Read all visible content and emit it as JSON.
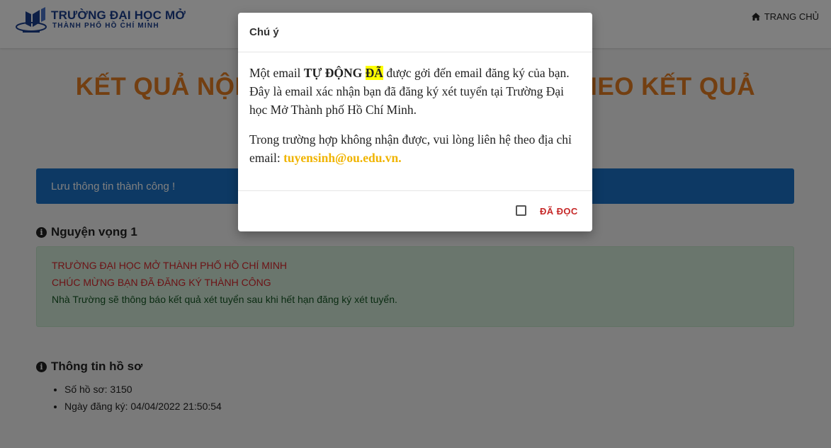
{
  "header": {
    "logo_line1": "TRƯỜNG ĐẠI HỌC MỞ",
    "logo_line2": "THÀNH PHỐ HỒ CHÍ MINH",
    "logo_icon": "university-book-logo",
    "nav_home_icon": "home-icon",
    "nav_home_label": "TRANG CHỦ"
  },
  "page": {
    "title_left": "KẾT QUẢ NỘP H",
    "title_right": "THEO KẾT QUẢ",
    "alert": "Lưu thông tin thành công !",
    "wish_heading": "Nguyện vọng 1",
    "wish_line1": "TRƯỜNG ĐẠI HỌC MỞ THÀNH PHỐ HỒ CHÍ MINH",
    "wish_line2": "CHÚC MỪNG BẠN ĐÃ ĐĂNG KÝ THÀNH CÔNG",
    "wish_line3": "Nhà Trường sẽ thông báo kết quả xét tuyển sau khi hết hạn đăng ký xét tuyển.",
    "profile_heading": "Thông tin hồ sơ",
    "profile_items": [
      "Số hồ sơ: 3150",
      "Ngày đăng ký: 04/04/2022 21:50:54"
    ]
  },
  "modal": {
    "title": "Chú ý",
    "p1_a": "Một email ",
    "p1_bold": "TỰ ĐỘNG",
    "p1_space": " ",
    "p1_highlight": "ĐÃ",
    "p1_b": " được gởi đến email đăng ký của bạn. Đây là email xác nhận bạn đã đăng ký xét tuyển tại Trường Đại học Mở Thành phố Hồ Chí Minh.",
    "p2_a": "Trong trường hợp không nhận được, vui lòng liên hệ theo địa chỉ email: ",
    "p2_email": "tuyensinh@ou.edu.vn.",
    "checkbox_label": "ĐÃ ĐỌC"
  },
  "colors": {
    "accent_title": "#e67e22",
    "alert_bg": "#1a73c8",
    "success_bg": "#d4edda",
    "email_color": "#f0b400",
    "highlight": "#ffff00",
    "read_label": "#c62828"
  }
}
